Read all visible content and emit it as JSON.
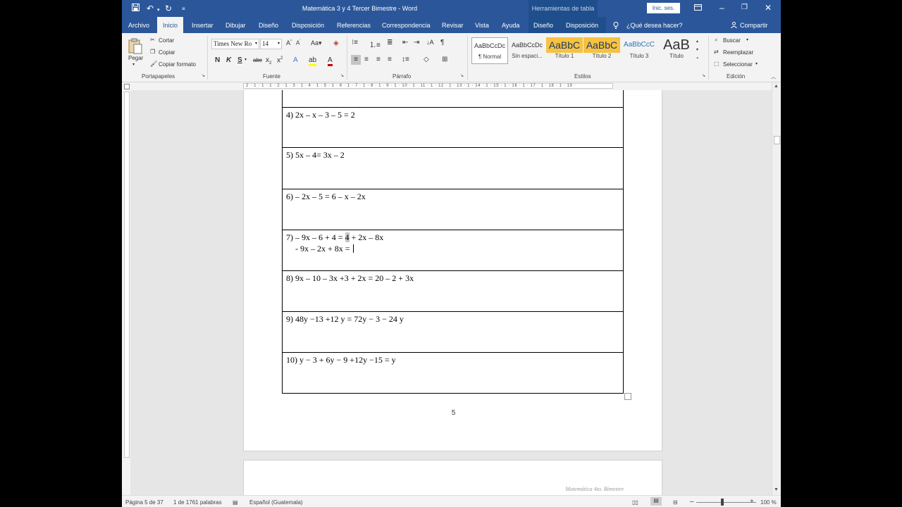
{
  "titlebar": {
    "doc_title": "Matemática 3 y 4 Tercer Bimestre  -  Word",
    "context_tab": "Herramientas de tabla",
    "signin": "Inic. ses."
  },
  "tabs": {
    "archivo": "Archivo",
    "inicio": "Inicio",
    "insertar": "Insertar",
    "dibujar": "Dibujar",
    "diseno": "Diseño",
    "disposicion": "Disposición",
    "referencias": "Referencias",
    "correspondencia": "Correspondencia",
    "revisar": "Revisar",
    "vista": "Vista",
    "ayuda": "Ayuda",
    "diseno_tabla": "Diseño",
    "disposicion_tabla": "Disposición",
    "tell_me": "¿Qué desea hacer?",
    "share": "Compartir"
  },
  "ribbon": {
    "clipboard": {
      "paste": "Pegar",
      "cut": "Cortar",
      "copy": "Copiar",
      "format_painter": "Copiar formato",
      "label": "Portapapeles"
    },
    "font": {
      "name": "Times New Ro",
      "size": "14",
      "label": "Fuente"
    },
    "paragraph": {
      "label": "Párrafo"
    },
    "styles": {
      "label": "Estilos",
      "items": [
        {
          "preview": "AaBbCcDc",
          "name": "¶ Normal"
        },
        {
          "preview": "AaBbCcDc",
          "name": "Sin espaci..."
        },
        {
          "preview": "AaBbC",
          "name": "Título 1"
        },
        {
          "preview": "AaBbC",
          "name": "Título 2"
        },
        {
          "preview": "AaBbCcC",
          "name": "Título 3"
        },
        {
          "preview": "AaB",
          "name": "Título"
        }
      ]
    },
    "editing": {
      "find": "Buscar",
      "replace": "Reemplazar",
      "select": "Seleccionar",
      "label": "Edición"
    }
  },
  "ruler": {
    "marks": "2 · 1 · 1 · 1 · 2 · 1 · 3 · 1 · 4 · 1 · 5 · 1 · 6 · 1 · 7 · 1 · 8 · 1 · 9 · 1 · 10 · 1 · 11 · 1 · 12 · 1 · 13 · 1 · 14 · 1 · 15 · 1 · 16 · 1 · 17 · 1 · 18 · 1 · 19 ·"
  },
  "document": {
    "rows": [
      {
        "lines": [
          ""
        ]
      },
      {
        "lines": [
          "4) 2x – x – 3 – 5 = 2"
        ]
      },
      {
        "lines": [
          "5) 5x – 4= 3x – 2"
        ]
      },
      {
        "lines": [
          "6) – 2x – 5 = 6 – x – 2x"
        ]
      },
      {
        "lines": [
          "7) – 9x – 6 + 4 = ",
          "4",
          " + 2x – 8x",
          "- 9x – 2x + 8x ="
        ]
      },
      {
        "lines": [
          "8) 9x – 10 – 3x +3 + 2x = 20 – 2 + 3x"
        ]
      },
      {
        "lines": [
          "9) 48y −13 +12 y = 72y − 3 − 24 y"
        ]
      },
      {
        "lines": [
          "10) y − 3 + 6y − 9 +12y −15 = y"
        ]
      }
    ],
    "page_number": "5",
    "footer": "Matemática 4to. Bimestre"
  },
  "statusbar": {
    "page": "Página 5 de 37",
    "words": "1 de 1761 palabras",
    "language": "Español (Guatemala)",
    "zoom": "100 %"
  }
}
